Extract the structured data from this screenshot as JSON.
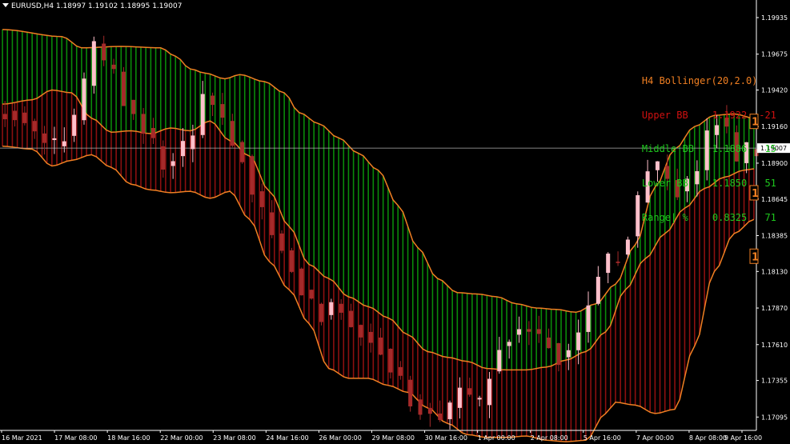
{
  "window": {
    "symbol_line": "EURUSD,H4  1.18997 1.19102 1.18995 1.19007"
  },
  "colors": {
    "background": "#000000",
    "upper_fill": "#0a8a0a",
    "lower_fill": "#8b1010",
    "band_line": "#f07f22",
    "bull_candle": "#ffc0cb",
    "bear_candle": "#a52a2a",
    "axis_text": "#ffffff",
    "bid_line": "#b0b0b0",
    "panel_title": "#f07f22",
    "panel_upper": "#d01010",
    "panel_middle": "#1ec81e",
    "panel_lower": "#1ec81e",
    "panel_range": "#1ec81e"
  },
  "indicator_panel": {
    "title": "H4 Bollinger(20,2.0)",
    "rows": [
      {
        "label": "Upper BB",
        "value": "1.1922",
        "points": "-21",
        "color": "#d01010"
      },
      {
        "label": "Middle BB",
        "value": "1.1886",
        "points": "15",
        "color": "#1ec81e"
      },
      {
        "label": "Lower BB",
        "value": "1.1850",
        "points": "51",
        "color": "#1ec81e"
      },
      {
        "label": "Range| %",
        "value": "0.8325",
        "points": "71",
        "color": "#1ec81e"
      }
    ]
  },
  "right_markers": [
    "1",
    "1",
    "1"
  ],
  "price_axis": {
    "labels": [
      "1.19935",
      "1.19675",
      "1.19420",
      "1.19160",
      "1.18900",
      "1.18645",
      "1.18385",
      "1.18130",
      "1.17870",
      "1.17610",
      "1.17355",
      "1.17095"
    ],
    "current_price": "1.19007"
  },
  "time_axis": {
    "labels": [
      "16 Mar 2021",
      "17 Mar 08:00",
      "18 Mar 16:00",
      "22 Mar 00:00",
      "23 Mar 08:00",
      "24 Mar 16:00",
      "26 Mar 00:00",
      "29 Mar 08:00",
      "30 Mar 16:00",
      "1 Apr 00:00",
      "2 Apr 08:00",
      "5 Apr 16:00",
      "7 Apr 00:00",
      "8 Apr 08:00",
      "9 Apr 16:00"
    ]
  },
  "chart_data": {
    "type": "candlestick",
    "symbol": "EURUSD",
    "timeframe": "H4",
    "ylim": [
      1.17,
      1.2006
    ],
    "y_ticks": [
      1.19935,
      1.19675,
      1.1942,
      1.1916,
      1.189,
      1.18645,
      1.18385,
      1.1813,
      1.1787,
      1.1761,
      1.17355,
      1.17095
    ],
    "current_price": 1.19007,
    "x_tick_labels": [
      "16 Mar 2021",
      "17 Mar 08:00",
      "18 Mar 16:00",
      "22 Mar 00:00",
      "23 Mar 08:00",
      "24 Mar 16:00",
      "26 Mar 00:00",
      "29 Mar 08:00",
      "30 Mar 16:00",
      "1 Apr 00:00",
      "2 Apr 08:00",
      "5 Apr 16:00",
      "7 Apr 00:00",
      "8 Apr 08:00",
      "9 Apr 16:00"
    ],
    "upper_band_anchors": [
      [
        0,
        1.1985
      ],
      [
        12,
        1.198
      ],
      [
        16,
        1.1972
      ],
      [
        24,
        1.1973
      ],
      [
        32,
        1.1972
      ],
      [
        35,
        1.1966
      ],
      [
        38,
        1.1957
      ],
      [
        41,
        1.1954
      ],
      [
        45,
        1.195
      ],
      [
        48,
        1.1953
      ],
      [
        53,
        1.1948
      ],
      [
        57,
        1.194
      ],
      [
        60,
        1.1926
      ],
      [
        64,
        1.1918
      ],
      [
        68,
        1.1908
      ],
      [
        72,
        1.1897
      ],
      [
        76,
        1.1885
      ],
      [
        80,
        1.186
      ],
      [
        84,
        1.183
      ],
      [
        88,
        1.1808
      ],
      [
        92,
        1.1798
      ],
      [
        96,
        1.1797
      ],
      [
        100,
        1.1795
      ],
      [
        104,
        1.179
      ],
      [
        108,
        1.1787
      ],
      [
        112,
        1.1786
      ],
      [
        116,
        1.1784
      ],
      [
        120,
        1.179
      ],
      [
        124,
        1.1804
      ],
      [
        128,
        1.1832
      ],
      [
        132,
        1.1873
      ],
      [
        136,
        1.19
      ],
      [
        140,
        1.1916
      ],
      [
        144,
        1.1924
      ],
      [
        148,
        1.1925
      ],
      [
        152,
        1.1922
      ]
    ],
    "lower_band_anchors": [
      [
        0,
        1.1902
      ],
      [
        6,
        1.19
      ],
      [
        10,
        1.1888
      ],
      [
        14,
        1.1892
      ],
      [
        18,
        1.1896
      ],
      [
        22,
        1.1887
      ],
      [
        26,
        1.1875
      ],
      [
        30,
        1.1871
      ],
      [
        34,
        1.1869
      ],
      [
        38,
        1.187
      ],
      [
        42,
        1.1865
      ],
      [
        46,
        1.187
      ],
      [
        50,
        1.185
      ],
      [
        54,
        1.182
      ],
      [
        58,
        1.18
      ],
      [
        62,
        1.1776
      ],
      [
        66,
        1.1744
      ],
      [
        70,
        1.1737
      ],
      [
        74,
        1.1737
      ],
      [
        78,
        1.1732
      ],
      [
        82,
        1.1727
      ],
      [
        86,
        1.1716
      ],
      [
        90,
        1.1705
      ],
      [
        94,
        1.1697
      ],
      [
        98,
        1.1695
      ],
      [
        102,
        1.1695
      ],
      [
        106,
        1.1696
      ],
      [
        110,
        1.1693
      ],
      [
        114,
        1.1692
      ],
      [
        118,
        1.1693
      ],
      [
        122,
        1.1712
      ],
      [
        124,
        1.172
      ],
      [
        128,
        1.1718
      ],
      [
        132,
        1.1712
      ],
      [
        136,
        1.1715
      ],
      [
        140,
        1.176
      ],
      [
        144,
        1.1813
      ],
      [
        148,
        1.184
      ],
      [
        152,
        1.185
      ]
    ],
    "middle_band_anchors": [
      [
        0,
        1.1932
      ],
      [
        6,
        1.1935
      ],
      [
        10,
        1.1942
      ],
      [
        14,
        1.194
      ],
      [
        18,
        1.1922
      ],
      [
        22,
        1.1912
      ],
      [
        26,
        1.1913
      ],
      [
        30,
        1.1911
      ],
      [
        34,
        1.1915
      ],
      [
        38,
        1.1913
      ],
      [
        42,
        1.192
      ],
      [
        46,
        1.1906
      ],
      [
        50,
        1.1895
      ],
      [
        54,
        1.187
      ],
      [
        58,
        1.1845
      ],
      [
        62,
        1.1818
      ],
      [
        66,
        1.1808
      ],
      [
        70,
        1.1795
      ],
      [
        74,
        1.1788
      ],
      [
        78,
        1.178
      ],
      [
        82,
        1.1768
      ],
      [
        86,
        1.1756
      ],
      [
        90,
        1.1752
      ],
      [
        94,
        1.1749
      ],
      [
        98,
        1.1744
      ],
      [
        102,
        1.1743
      ],
      [
        106,
        1.1743
      ],
      [
        110,
        1.1745
      ],
      [
        114,
        1.175
      ],
      [
        118,
        1.1756
      ],
      [
        122,
        1.177
      ],
      [
        126,
        1.18
      ],
      [
        130,
        1.1822
      ],
      [
        134,
        1.184
      ],
      [
        138,
        1.1858
      ],
      [
        142,
        1.1872
      ],
      [
        146,
        1.188
      ],
      [
        150,
        1.1885
      ],
      [
        152,
        1.1886
      ]
    ],
    "price_anchors": [
      [
        0,
        1.1925
      ],
      [
        3,
        1.1928
      ],
      [
        6,
        1.192
      ],
      [
        9,
        1.1908
      ],
      [
        12,
        1.1902
      ],
      [
        15,
        1.1912
      ],
      [
        18,
        1.1945
      ],
      [
        20,
        1.1975
      ],
      [
        22,
        1.196
      ],
      [
        24,
        1.1955
      ],
      [
        26,
        1.1935
      ],
      [
        28,
        1.1925
      ],
      [
        30,
        1.1915
      ],
      [
        32,
        1.1902
      ],
      [
        34,
        1.1888
      ],
      [
        36,
        1.1895
      ],
      [
        38,
        1.19
      ],
      [
        40,
        1.191
      ],
      [
        42,
        1.1938
      ],
      [
        44,
        1.1932
      ],
      [
        46,
        1.192
      ],
      [
        48,
        1.1905
      ],
      [
        50,
        1.1895
      ],
      [
        52,
        1.187
      ],
      [
        54,
        1.1855
      ],
      [
        56,
        1.184
      ],
      [
        58,
        1.1828
      ],
      [
        60,
        1.1815
      ],
      [
        62,
        1.18
      ],
      [
        64,
        1.179
      ],
      [
        66,
        1.1782
      ],
      [
        68,
        1.179
      ],
      [
        70,
        1.1785
      ],
      [
        72,
        1.1775
      ],
      [
        74,
        1.177
      ],
      [
        76,
        1.1766
      ],
      [
        78,
        1.1758
      ],
      [
        80,
        1.1745
      ],
      [
        82,
        1.1736
      ],
      [
        84,
        1.1722
      ],
      [
        86,
        1.1716
      ],
      [
        88,
        1.1712
      ],
      [
        90,
        1.1708
      ],
      [
        92,
        1.1716
      ],
      [
        94,
        1.173
      ],
      [
        96,
        1.1722
      ],
      [
        98,
        1.1718
      ],
      [
        100,
        1.1742
      ],
      [
        102,
        1.176
      ],
      [
        104,
        1.1768
      ],
      [
        106,
        1.1772
      ],
      [
        108,
        1.1772
      ],
      [
        110,
        1.1766
      ],
      [
        112,
        1.1762
      ],
      [
        114,
        1.1752
      ],
      [
        116,
        1.1757
      ],
      [
        118,
        1.177
      ],
      [
        120,
        1.179
      ],
      [
        122,
        1.1812
      ],
      [
        124,
        1.182
      ],
      [
        126,
        1.1825
      ],
      [
        128,
        1.1838
      ],
      [
        130,
        1.1862
      ],
      [
        132,
        1.1885
      ],
      [
        134,
        1.1888
      ],
      [
        136,
        1.1878
      ],
      [
        138,
        1.187
      ],
      [
        140,
        1.1875
      ],
      [
        142,
        1.1885
      ],
      [
        144,
        1.191
      ],
      [
        146,
        1.1922
      ],
      [
        148,
        1.1912
      ],
      [
        150,
        1.189
      ],
      [
        152,
        1.19
      ]
    ]
  }
}
